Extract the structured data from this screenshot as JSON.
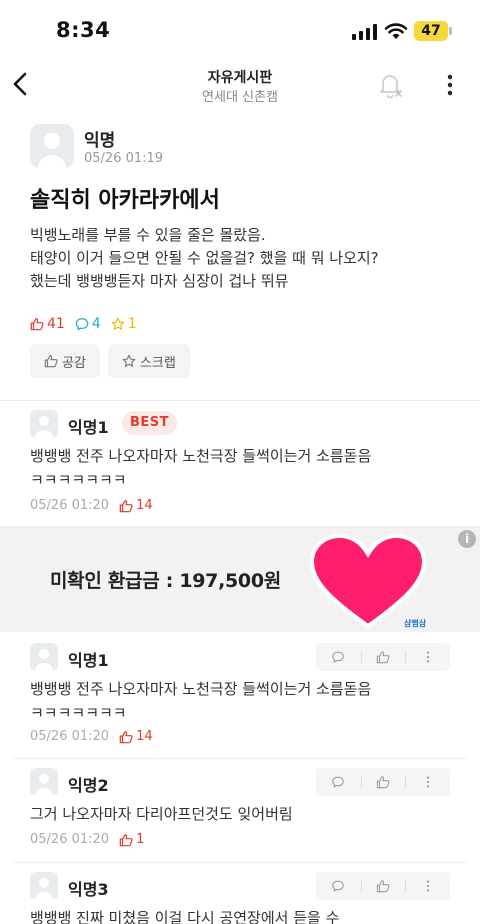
{
  "status": {
    "time": "8:34",
    "battery": "47"
  },
  "nav": {
    "title": "자유게시판",
    "subtitle": "연세대 신촌캠"
  },
  "post": {
    "author": "익명",
    "time": "05/26 01:19",
    "title": "솔직히 아카라카에서",
    "body": "빅뱅노래를 부를 수 있을 줄은 몰랐음.\n태양이 이거 들으면 안될 수 없을걸? 했을 때 뭐 나오지?\n했는데 뱅뱅뱅듣자 마자 심장이 겁나 뛰뮤",
    "likes": "41",
    "comments": "4",
    "scraps": "1",
    "like_button": "공감",
    "scrap_button": "스크랩"
  },
  "best_comment": {
    "author": "익명1",
    "badge": "BEST",
    "text": "뱅뱅뱅 전주 나오자마자 노천극장 들썩이는거 소름돋음\nㅋㅋㅋㅋㅋㅋㅋ",
    "time": "05/26 01:20",
    "likes": "14"
  },
  "ad": {
    "text": "미확인 환급금 : 197,500원",
    "brand": "삼쩜삼",
    "info": "i"
  },
  "comments": [
    {
      "author": "익명1",
      "text": "뱅뱅뱅 전주 나오자마자 노천극장 들썩이는거 소름돋음\nㅋㅋㅋㅋㅋㅋㅋ",
      "time": "05/26 01:20",
      "likes": "14"
    },
    {
      "author": "익명2",
      "text": "그거 나오자마자 다리아프던것도 잊어버림",
      "time": "05/26 01:20",
      "likes": "1"
    },
    {
      "author": "익명3",
      "text": "뱅뱅뱅 진짜 미쳤음 이걸 다시 공연장에서 듣을 수"
    }
  ],
  "colors": {
    "accent_red": "#e13c2c",
    "comment_teal": "#1ab0c9",
    "scrap_yellow": "#e7b700",
    "ad_heart": "#ff1e6e"
  }
}
